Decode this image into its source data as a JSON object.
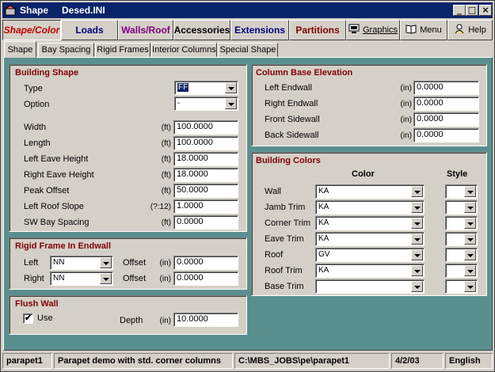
{
  "window": {
    "app_title": "Shape",
    "file_title": "Desed.INI"
  },
  "toolbar": {
    "shape_color": "Shape/Color",
    "loads": "Loads",
    "walls_roof": "Walls/Roof",
    "accessories": "Accessories",
    "extensions": "Extensions",
    "partitions": "Partitions",
    "graphics": "Graphics",
    "menu": "Menu",
    "help": "Help"
  },
  "colors": {
    "shape_color": "#c00000",
    "walls_roof": "#800080",
    "extensions": "#000080",
    "partitions": "#800000",
    "group_title": "#800000",
    "panel_bg": "#5a8f8f",
    "title_bar": "#0a246a"
  },
  "tabs": [
    "Shape",
    "Bay Spacing",
    "Rigid Frames",
    "Interior Columns",
    "Special Shape"
  ],
  "building_shape": {
    "title": "Building Shape",
    "type_label": "Type",
    "type_value": "FF",
    "option_label": "Option",
    "option_value": "-",
    "fields": [
      {
        "label": "Width",
        "unit": "(ft)",
        "value": "100.0000"
      },
      {
        "label": "Length",
        "unit": "(ft)",
        "value": "100.0000"
      },
      {
        "label": "Left Eave Height",
        "unit": "(ft)",
        "value": "18.0000"
      },
      {
        "label": "Right Eave Height",
        "unit": "(ft)",
        "value": "18.0000"
      },
      {
        "label": "Peak Offset",
        "unit": "(ft)",
        "value": "50.0000"
      },
      {
        "label": "Left Roof Slope",
        "unit": "(?:12)",
        "value": "1.0000"
      },
      {
        "label": "SW Bay Spacing",
        "unit": "(ft)",
        "value": "0.0000"
      }
    ]
  },
  "rigid_frame": {
    "title": "Rigid Frame In Endwall",
    "rows": [
      {
        "label": "Left",
        "value": "NN",
        "offset_label": "Offset",
        "unit": "(in)",
        "offset": "0.0000"
      },
      {
        "label": "Right",
        "value": "NN",
        "offset_label": "Offset",
        "unit": "(in)",
        "offset": "0.0000"
      }
    ]
  },
  "flush_wall": {
    "title": "Flush Wall",
    "use_label": "Use",
    "use_checked": "✔",
    "depth_label": "Depth",
    "unit": "(in)",
    "depth": "10.0000"
  },
  "column_base": {
    "title": "Column Base Elevation",
    "fields": [
      {
        "label": "Left Endwall",
        "unit": "(in)",
        "value": "0.0000"
      },
      {
        "label": "Right Endwall",
        "unit": "(in)",
        "value": "0.0000"
      },
      {
        "label": "Front Sidewall",
        "unit": "(in)",
        "value": "0.0000"
      },
      {
        "label": "Back Sidewall",
        "unit": "(in)",
        "value": "0.0000"
      }
    ]
  },
  "building_colors": {
    "title": "Building Colors",
    "color_header": "Color",
    "style_header": "Style",
    "rows": [
      {
        "label": "Wall",
        "color": "KA"
      },
      {
        "label": "Jamb Trim",
        "color": "KA"
      },
      {
        "label": "Corner Trim",
        "color": "KA"
      },
      {
        "label": "Eave Trim",
        "color": "KA"
      },
      {
        "label": "Roof",
        "color": "GV"
      },
      {
        "label": "Roof Trim",
        "color": "KA"
      },
      {
        "label": "Base Trim",
        "color": ""
      }
    ]
  },
  "status": {
    "name": "parapet1",
    "desc": "Parapet demo with std. corner columns",
    "path": "C:\\MBS_JOBS\\pe\\parapet1",
    "date": "4/2/03",
    "lang": "English"
  }
}
